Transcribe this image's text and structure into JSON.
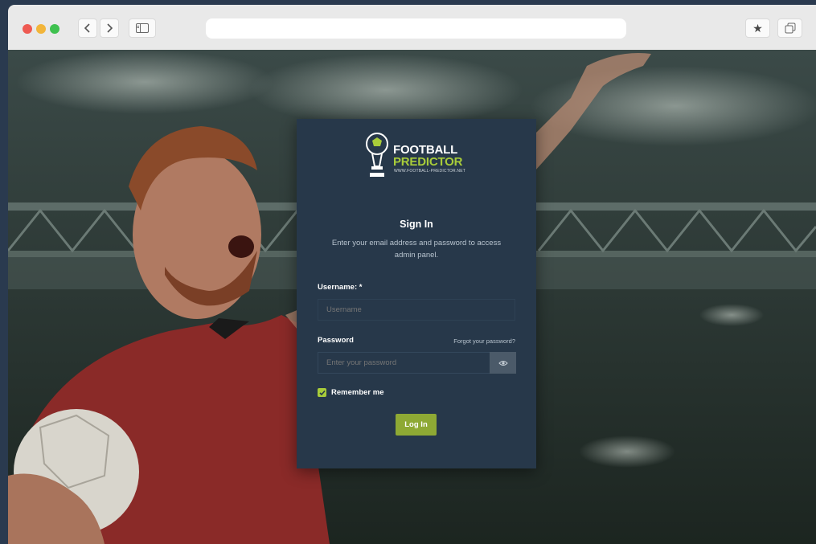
{
  "browser": {
    "icons": {
      "back": "chevron-left-icon",
      "forward": "chevron-right-icon",
      "sidebar": "sidebar-icon",
      "bookmark": "star-icon",
      "tabs": "tabs-icon"
    },
    "colors": {
      "close": "#ee5a52",
      "minimize": "#f2b53a",
      "zoom": "#3fc14f"
    }
  },
  "logo": {
    "line1": "FOOTBALL",
    "line2": "PREDICTOR",
    "url": "WWW.FOOTBALL-PREDICTOR.NET",
    "accent": "#a8cc3a"
  },
  "signin": {
    "title": "Sign In",
    "subtitle": "Enter your email address and password to access admin panel."
  },
  "form": {
    "username_label": "Username: *",
    "username_placeholder": "Username",
    "password_label": "Password",
    "forgot_link": "Forgot your password?",
    "password_placeholder": "Enter your password",
    "remember_label": "Remember me",
    "remember_checked": true,
    "login_button": "Log In",
    "button_color": "#8ea934"
  }
}
